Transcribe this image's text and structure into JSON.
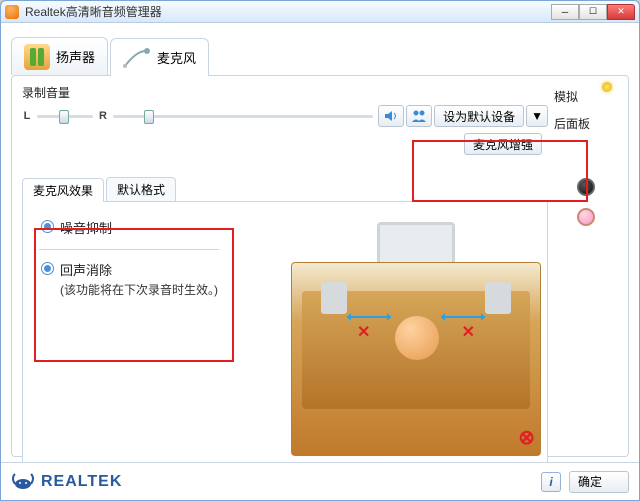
{
  "window": {
    "title": "Realtek高清晰音频管理器"
  },
  "top_tabs": {
    "speakers": "扬声器",
    "microphone": "麦克风",
    "active": "microphone"
  },
  "volume": {
    "section_label": "录制音量",
    "left_label": "L",
    "right_label": "R",
    "position_percent": 12
  },
  "toolbar": {
    "mute_icon": "speaker-icon",
    "playback_icon": "people-icon",
    "default_device_label": "设为默认设备",
    "mic_boost_label": "麦克风增强"
  },
  "inner_tabs": {
    "effects": "麦克风效果",
    "default_format": "默认格式",
    "active": "effects"
  },
  "effects": {
    "noise_suppression": {
      "label": "噪音抑制",
      "checked": true
    },
    "echo_cancellation": {
      "label": "回声消除",
      "note": "(该功能将在下次录音时生效。)",
      "checked": true
    }
  },
  "side_panel": {
    "title": "模拟",
    "subtitle": "后面板"
  },
  "footer": {
    "brand": "REALTEK",
    "ok_label": "确定"
  }
}
